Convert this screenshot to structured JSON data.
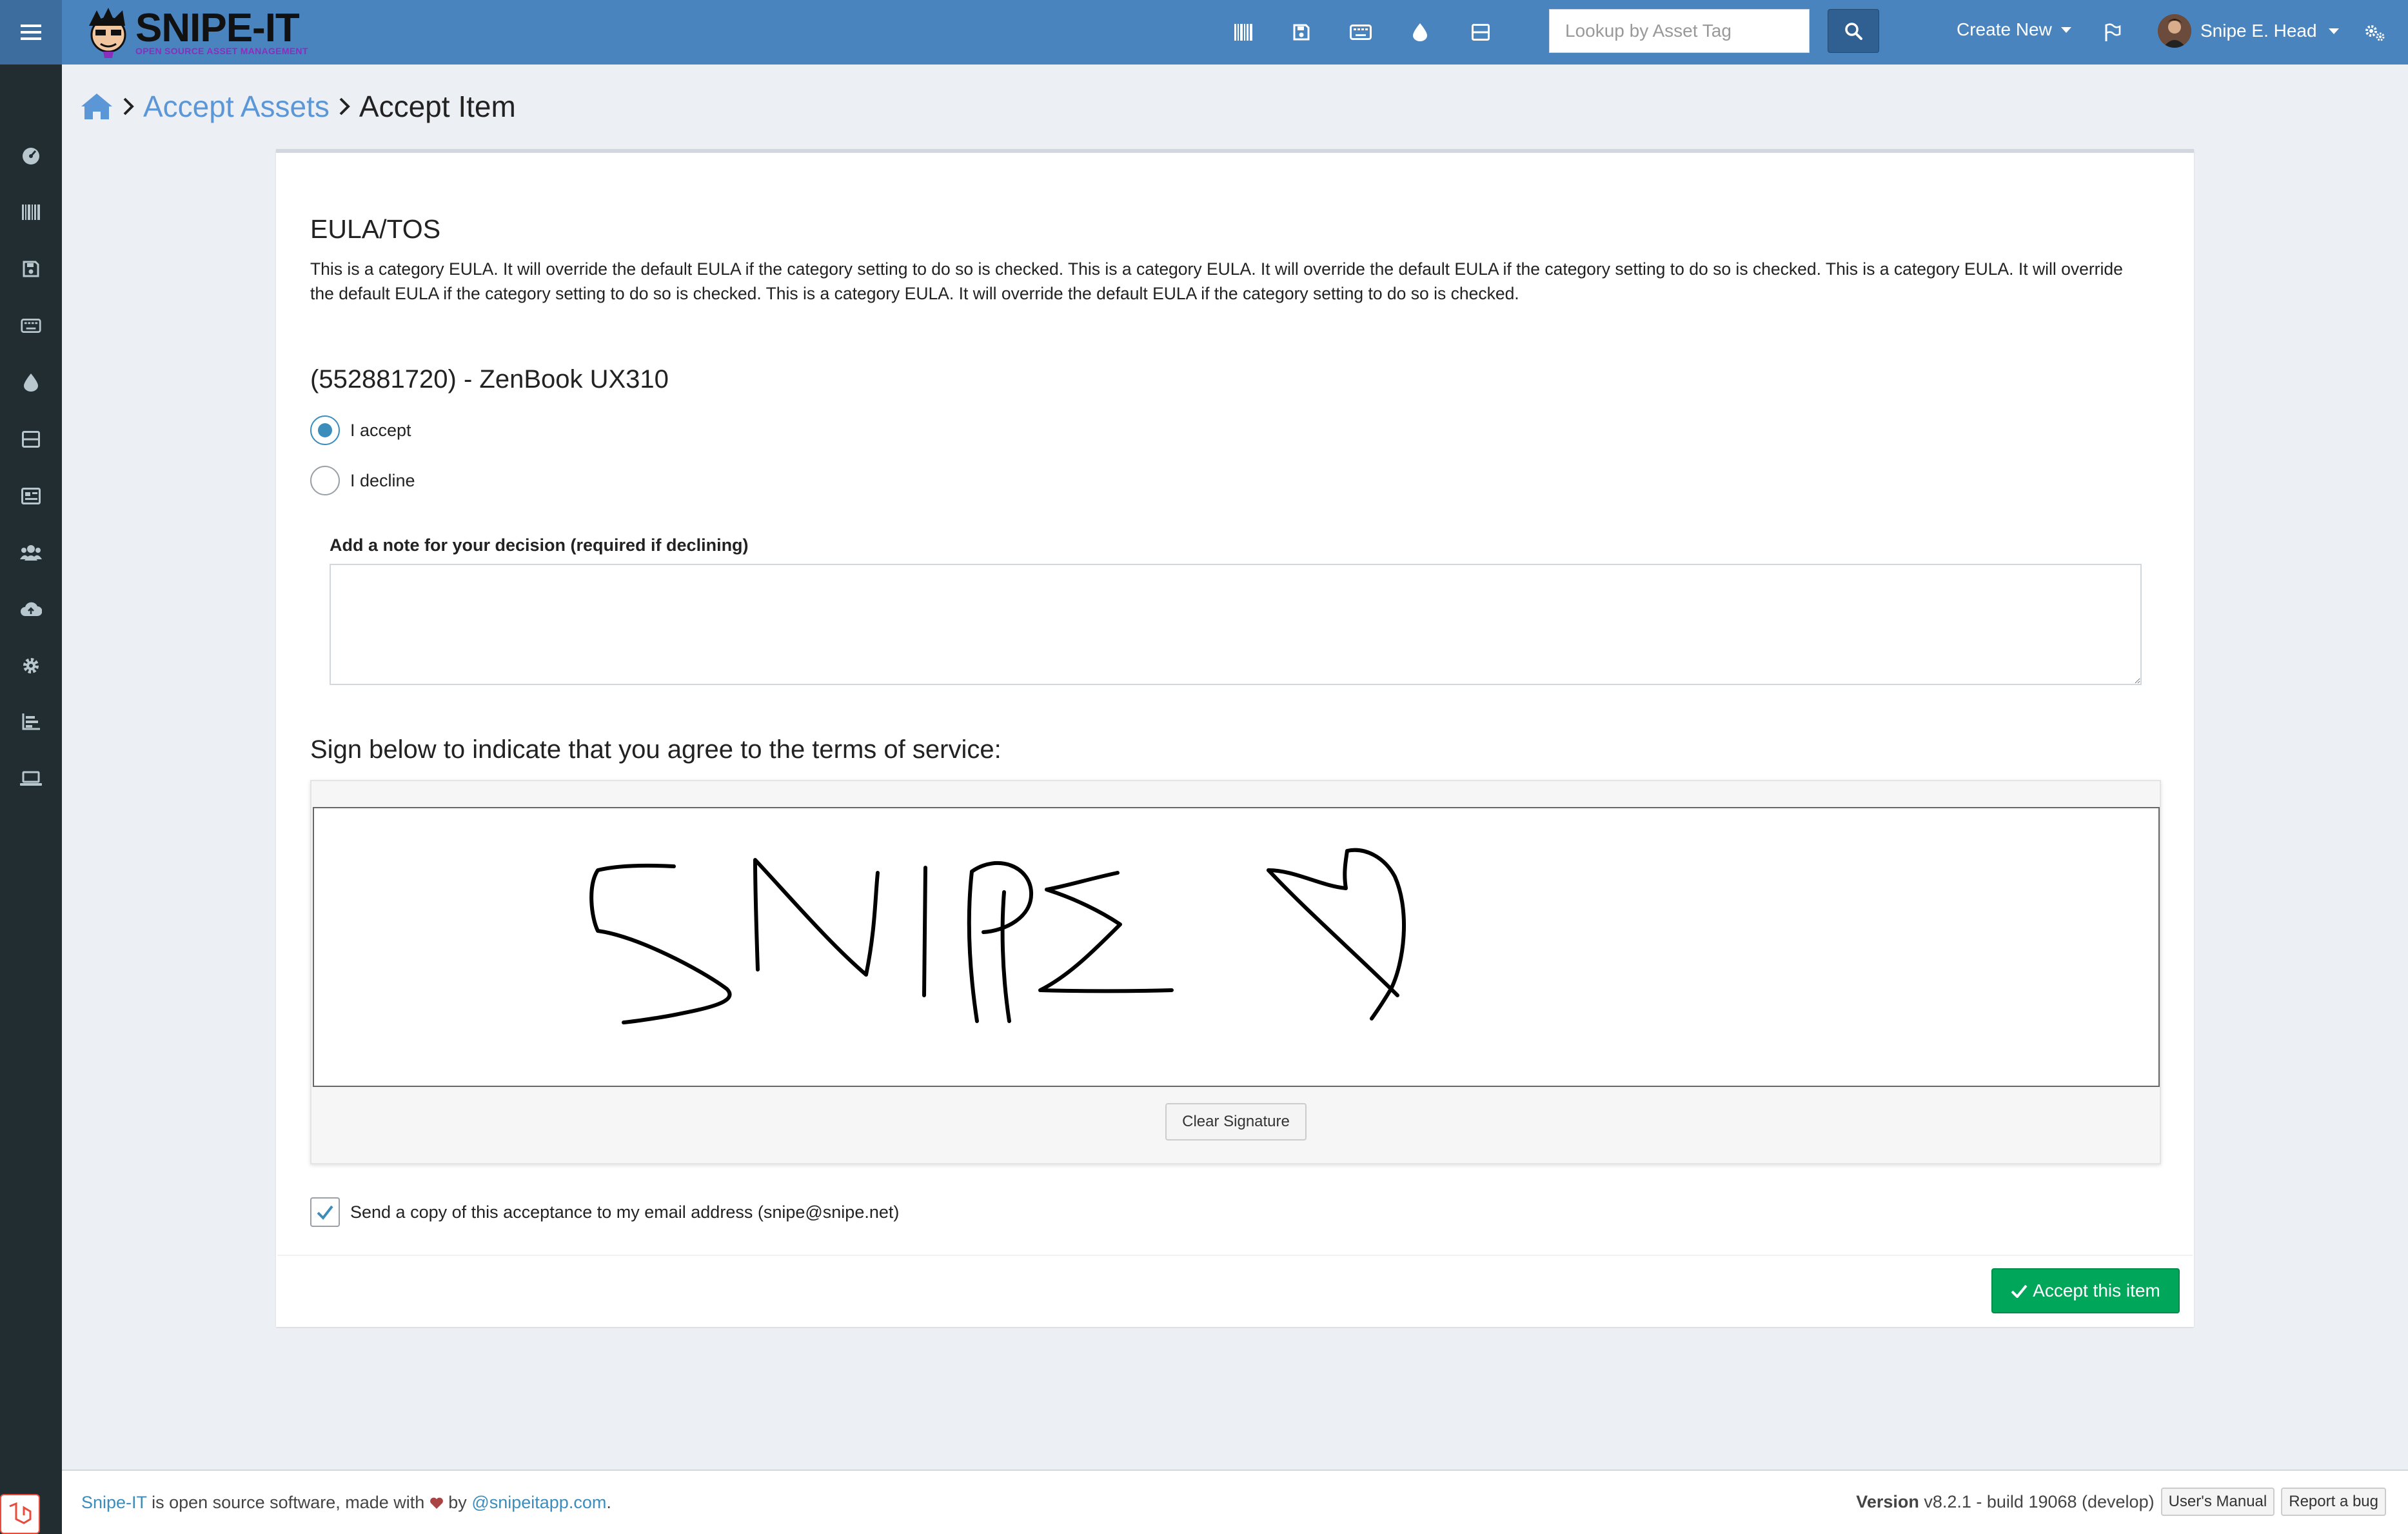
{
  "app": {
    "logo_text": "SNIPE-IT",
    "logo_tagline": "OPEN SOURCE ASSET MANAGEMENT"
  },
  "topbar": {
    "icons": [
      "barcode-icon",
      "save-icon",
      "keyboard-icon",
      "tint-icon",
      "server-icon"
    ],
    "search_placeholder": "Lookup by Asset Tag",
    "create_new": "Create New",
    "user_name": "Snipe E. Head"
  },
  "sidebar": {
    "icons": [
      "dashboard-icon",
      "barcode-icon",
      "save-icon",
      "keyboard-icon",
      "tint-icon",
      "server-icon",
      "licenses-icon",
      "users-icon",
      "cloud-upload-icon",
      "settings-icon",
      "reports-icon",
      "laptop-icon"
    ]
  },
  "breadcrumb": {
    "items": [
      "Accept Assets",
      "Accept Item"
    ]
  },
  "eula": {
    "title": "EULA/TOS",
    "text": "This is a category EULA. It will override the default EULA if the category setting to do so is checked. This is a category EULA. It will override the default EULA if the category setting to do so is checked. This is a category EULA. It will override the default EULA if the category setting to do so is checked. This is a category EULA. It will override the default EULA if the category setting to do so is checked."
  },
  "item": {
    "title": "(552881720) - ZenBook UX310"
  },
  "decision": {
    "accept_label": "I accept",
    "decline_label": "I decline",
    "selected": "accept"
  },
  "note": {
    "label": "Add a note for your decision (required if declining)",
    "value": ""
  },
  "signature": {
    "label": "Sign below to indicate that you agree to the terms of service:",
    "clear_label": "Clear Signature"
  },
  "email_copy": {
    "label": "Send a copy of this acceptance to my email address (snipe@snipe.net)",
    "checked": true
  },
  "actions": {
    "accept_label": "Accept this item"
  },
  "footer": {
    "brand": "Snipe-IT",
    "text1": " is open source software, made with ",
    "text2": " by ",
    "author": "@snipeitapp.com",
    "text3": ".",
    "version_label": "Version",
    "version_value": " v8.2.1 - build 19068 (develop)",
    "manual_label": "User's Manual",
    "bug_label": "Report a bug"
  },
  "colors": {
    "topbar": "#4a84be",
    "sidebar": "#222d32",
    "accent": "#3c8dbc",
    "success": "#00a65a"
  }
}
